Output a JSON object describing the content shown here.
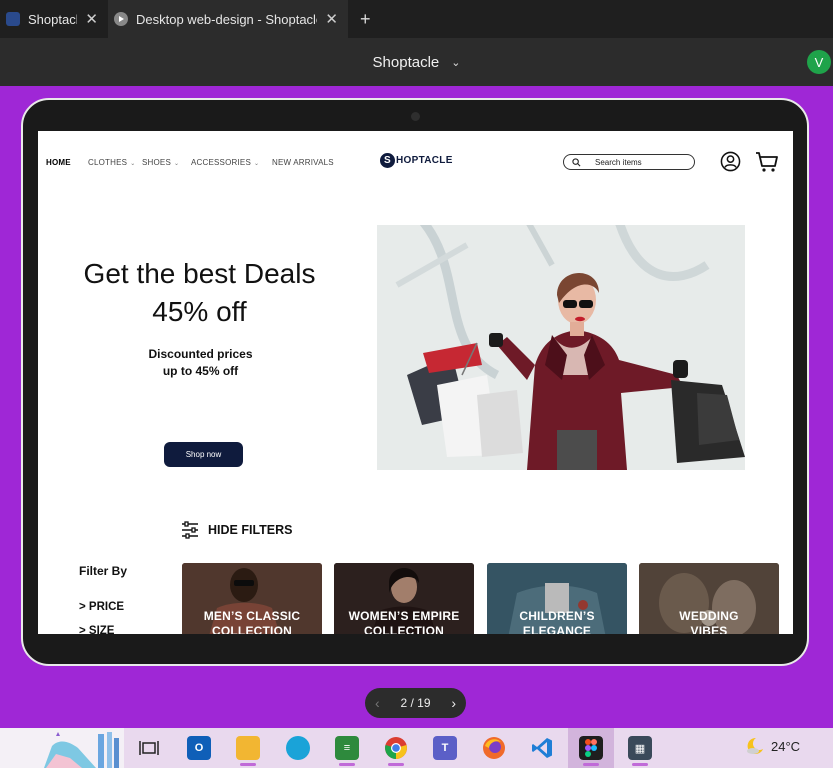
{
  "browser": {
    "tabs": [
      {
        "label": "Shoptacle"
      },
      {
        "label": "Desktop web-design - Shoptacle"
      }
    ],
    "close_glyph": "✕",
    "new_tab_glyph": "+"
  },
  "header": {
    "file_title": "Shoptacle",
    "caret_glyph": "⌄",
    "avatar_initial": "V"
  },
  "site": {
    "nav": {
      "home": "HOME",
      "clothes": "CLOTHES",
      "shoes": "SHOES",
      "accessories": "ACCESSORIES",
      "new_arrivals": "NEW ARRIVALS",
      "dropdown_glyph": "⌄"
    },
    "logo": {
      "initial": "S",
      "rest": "HOPTACLE"
    },
    "search_placeholder": "Search items",
    "hero": {
      "title_line1": "Get the best Deals",
      "title_line2": "45% off",
      "sub_line1": "Discounted prices",
      "sub_line2": "up to 45% off",
      "cta": "Shop now"
    },
    "filters": {
      "hide_label": "HIDE FILTERS",
      "filter_by": "Filter By",
      "options": [
        "> PRICE",
        "> SIZE"
      ]
    },
    "categories": [
      {
        "line1": "MEN’S CLASSIC",
        "line2": "COLLECTION"
      },
      {
        "line1": "WOMEN’S EMPIRE",
        "line2": "COLLECTION"
      },
      {
        "line1": "CHILDREN’S",
        "line2": "ELEGANCE"
      },
      {
        "line1": "WEDDING",
        "line2": "VIBES"
      }
    ]
  },
  "pager": {
    "text": "2 / 19",
    "prev": "‹",
    "next": "›"
  },
  "taskbar": {
    "temperature": "24°C"
  },
  "colors": {
    "background": "#9f27d6",
    "brand_navy": "#0f1b3d",
    "avatar_green": "#1fa34a"
  }
}
